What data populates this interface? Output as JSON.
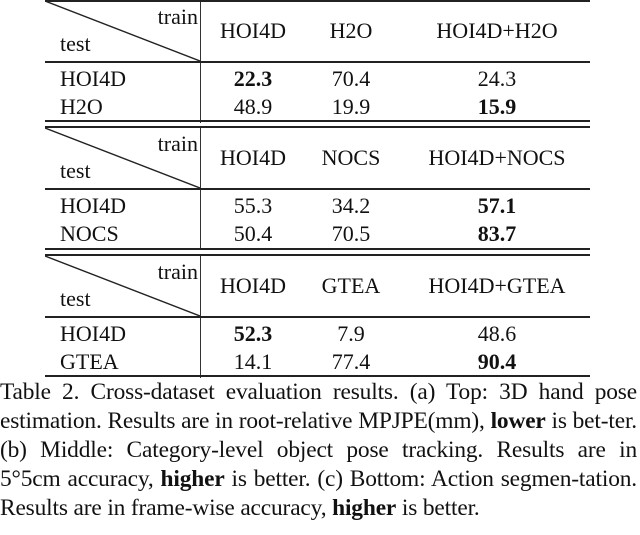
{
  "tables": [
    {
      "id": "a",
      "corner": {
        "train_label": "train",
        "test_label": "test"
      },
      "columns": [
        "HOI4D",
        "H2O",
        "HOI4D+H2O"
      ],
      "rows": [
        {
          "label": "HOI4D",
          "values": [
            "22.3",
            "70.4",
            "24.3"
          ],
          "bold": [
            true,
            false,
            false
          ]
        },
        {
          "label": "H2O",
          "values": [
            "48.9",
            "19.9",
            "15.9"
          ],
          "bold": [
            false,
            false,
            true
          ]
        }
      ]
    },
    {
      "id": "b",
      "corner": {
        "train_label": "train",
        "test_label": "test"
      },
      "columns": [
        "HOI4D",
        "NOCS",
        "HOI4D+NOCS"
      ],
      "rows": [
        {
          "label": "HOI4D",
          "values": [
            "55.3",
            "34.2",
            "57.1"
          ],
          "bold": [
            false,
            false,
            true
          ]
        },
        {
          "label": "NOCS",
          "values": [
            "50.4",
            "70.5",
            "83.7"
          ],
          "bold": [
            false,
            false,
            true
          ]
        }
      ]
    },
    {
      "id": "c",
      "corner": {
        "train_label": "train",
        "test_label": "test"
      },
      "columns": [
        "HOI4D",
        "GTEA",
        "HOI4D+GTEA"
      ],
      "rows": [
        {
          "label": "HOI4D",
          "values": [
            "52.3",
            "7.9",
            "48.6"
          ],
          "bold": [
            true,
            false,
            false
          ]
        },
        {
          "label": "GTEA",
          "values": [
            "14.1",
            "77.4",
            "90.4"
          ],
          "bold": [
            false,
            false,
            true
          ]
        }
      ]
    }
  ],
  "caption": {
    "parts": [
      {
        "text": "Table 2.  Cross-dataset evaluation results.  (a) Top:  3D hand pose estimation. Results are in root-relative MPJPE(mm), ",
        "bold": false
      },
      {
        "text": "lower",
        "bold": true
      },
      {
        "text": " is bet-ter.  (b) Middle: Category-level object pose tracking.  Results are in 5°5cm accuracy, ",
        "bold": false
      },
      {
        "text": "higher",
        "bold": true
      },
      {
        "text": " is better.  (c) Bottom: Action segmen-tation. Results are in frame-wise accuracy, ",
        "bold": false
      },
      {
        "text": "higher",
        "bold": true
      },
      {
        "text": " is better.",
        "bold": false
      }
    ]
  }
}
